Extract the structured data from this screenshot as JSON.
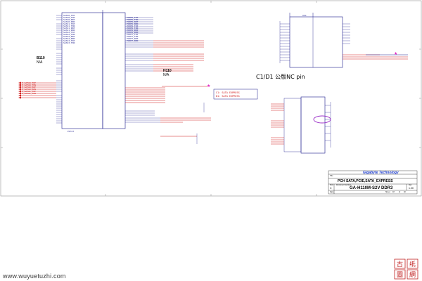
{
  "title_block": {
    "company": "Gigabyte Technology",
    "sheet_title": "PCH SATA,PCIE,SATA_EXPRESS",
    "model": "GA-H110M-S2V DDR3",
    "rev_label": "Rev",
    "rev_value": "1.00",
    "size_label": "Size",
    "size_value": "C",
    "doc_label": "Document Number",
    "title_label": "Title",
    "date_label": "Date:",
    "sheet_label": "Sheet",
    "of_label": "of",
    "sheet_num": "18",
    "sheet_total": "40"
  },
  "labels": {
    "b110_left": "B110",
    "na_left": "N/A",
    "h110_mid": "H110",
    "na_mid": "N/A",
    "c1d1_note": "C1/D1  公版NC  pin",
    "note_box_line1": "C1: SATA EXPRESS",
    "note_box_line2": "D1: SATA EXPRESS",
    "pch_bottom": "PCH-H",
    "u_ref": "U1G"
  },
  "left_pins": [
    "SATA0_TXP",
    "SATA0_TXN",
    "SATA0_RXP",
    "SATA0_RXN",
    "SATA1_TXP",
    "SATA1_TXN",
    "SATA1_RXP",
    "SATA1_RXN",
    "SATA2_TXP",
    "SATA2_TXN",
    "SATA2_RXP",
    "SATA2_RXN",
    "SATA3_TXP",
    "SATA3_TXN"
  ],
  "red_nets": [
    "P_SATA0_TXP",
    "P_SATA0_TXN",
    "P_SATA0_RXP",
    "P_SATA0_RXN",
    "P_SATA1_TXP",
    "P_SATA1_TXN"
  ],
  "right_pins": [
    "PCIE5_TXP",
    "PCIE5_TXN",
    "PCIE5_RXP",
    "PCIE5_RXN",
    "PCIE6_TXP",
    "PCIE6_TXN",
    "PCIE6_RXP",
    "PCIE6_RXN",
    "PCIE7_TXP",
    "PCIE7_TXN",
    "PCIE7_RXP",
    "PCIE7_RXN"
  ],
  "watermark": "www.wuyuetuzhi.com",
  "logo_text": [
    "古",
    "纸",
    "圖",
    "網"
  ],
  "colors": {
    "wire": "#1a1a8c",
    "net_red": "#d01818",
    "highlight": "#9b30c8",
    "marker": "#e020c0"
  }
}
